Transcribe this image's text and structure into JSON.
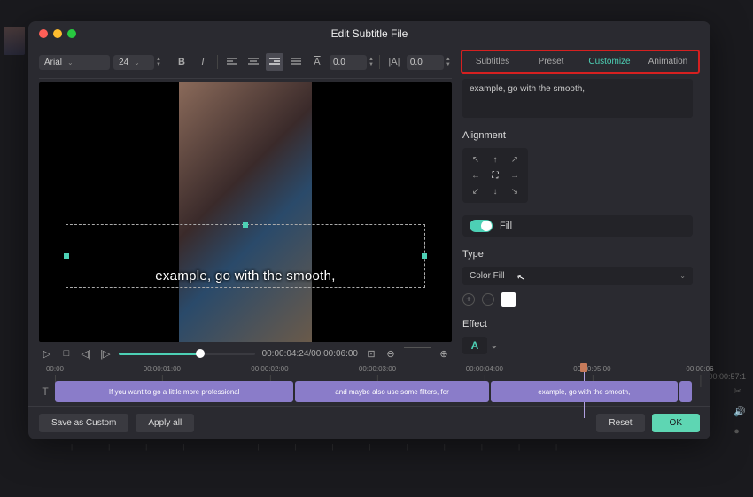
{
  "window": {
    "title": "Edit Subtitle File"
  },
  "toolbar": {
    "font": "Arial",
    "size": "24",
    "spacing1": "0.0",
    "spacing2": "0.0"
  },
  "preview": {
    "subtitle_text": "example, go with the smooth,"
  },
  "playback": {
    "time": "00:00:04:24/00:00:06:00"
  },
  "tabs": {
    "subtitles": "Subtitles",
    "preset": "Preset",
    "customize": "Customize",
    "animation": "Animation"
  },
  "panel": {
    "textarea_value": "example, go with the smooth,",
    "alignment_label": "Alignment",
    "fill_label": "Fill",
    "type_label": "Type",
    "type_value": "Color Fill",
    "effect_label": "Effect",
    "effect_symbol": "A"
  },
  "timeline": {
    "marks": [
      "00:00",
      "00:00:01:00",
      "00:00:02:00",
      "00:00:03:00",
      "00:00:04:00",
      "00:00:05:00",
      "00:00:06"
    ],
    "clips": [
      {
        "text": "If you want to go a little more professional",
        "width": "37%"
      },
      {
        "text": "and maybe also use some filters, for",
        "width": "30%"
      },
      {
        "text": "example, go with the smooth,",
        "width": "29%"
      },
      {
        "text": "",
        "width": "2%"
      }
    ]
  },
  "footer": {
    "save_custom": "Save as Custom",
    "apply_all": "Apply all",
    "reset": "Reset",
    "ok": "OK"
  },
  "background": {
    "time_display": "00:00:57:1"
  }
}
